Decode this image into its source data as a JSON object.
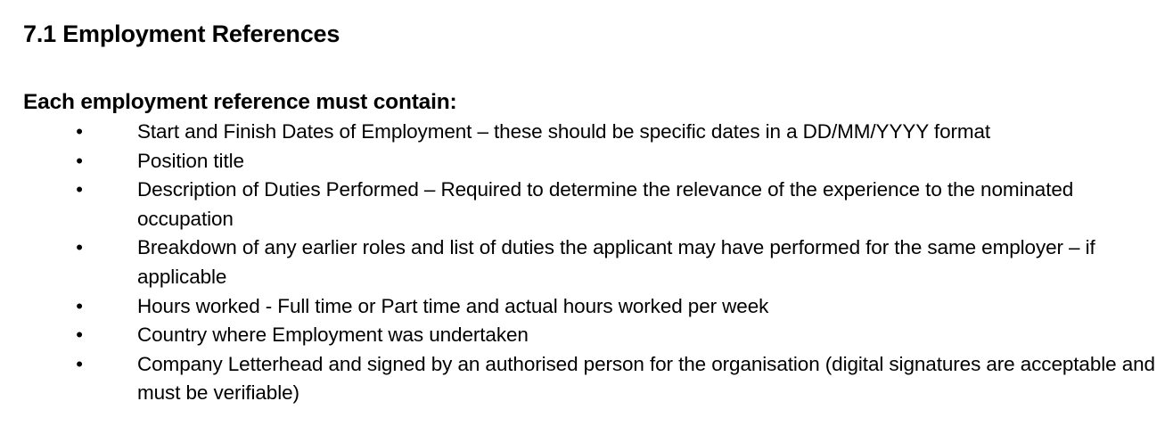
{
  "section": {
    "heading": "7.1 Employment References",
    "subheading": "Each employment reference must contain:",
    "bullet_symbol": "•",
    "items": [
      "Start and Finish Dates of Employment – these should be specific dates in a DD/MM/YYYY format",
      "Position title",
      "Description of Duties Performed – Required to determine the relevance of the experience to the nominated occupation",
      "Breakdown of any earlier roles and list of duties the applicant may have performed for the same employer – if applicable",
      "Hours worked - Full time or Part time and actual hours worked per week",
      "Country where Employment was undertaken",
      "Company Letterhead and signed by an authorised person for the organisation (digital signatures are acceptable and must be verifiable)"
    ]
  }
}
